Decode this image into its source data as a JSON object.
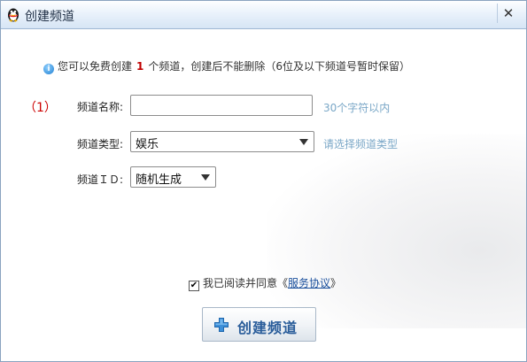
{
  "window": {
    "title": "创建频道",
    "close_symbol": "✕",
    "logo_icon": "qq-penguin-icon"
  },
  "notice": {
    "info_symbol": "i",
    "prefix": "您可以免费创建",
    "count": "1",
    "suffix": "个频道，创建后不能删除（6位及以下频道号暂时保留）"
  },
  "step_marker": "（1）",
  "form": {
    "name_label": "频道名称:",
    "name_value": "",
    "name_hint": "30个字符以内",
    "type_label": "频道类型:",
    "type_value": "娱乐",
    "type_hint": "请选择频道类型",
    "id_label": "频道ＩＤ:",
    "id_value": "随机生成"
  },
  "agreement": {
    "checked_symbol": "✔",
    "checked": true,
    "text_prefix": "我已阅读并同意《",
    "link": "服务协议",
    "text_suffix": "》"
  },
  "create_button": {
    "label": "创建频道"
  },
  "colors": {
    "accent": "#2a5d9a",
    "count_red": "#c00000",
    "hint_blue": "#7aa7c7",
    "plus_blue": "#3d8fd8"
  }
}
